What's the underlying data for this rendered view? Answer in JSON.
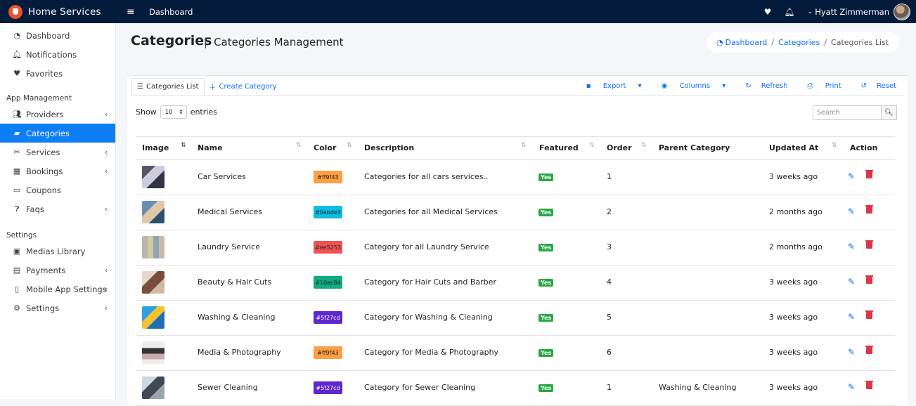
{
  "topbar": {
    "brand": "Home Services",
    "menu_icon": "≡",
    "page_label": "Dashboard",
    "user_name": "Hyatt Zimmerman"
  },
  "sidebar": {
    "items_top": [
      {
        "label": "Dashboard",
        "icon": "dashboard-icon"
      },
      {
        "label": "Notifications",
        "icon": "bell-icon"
      },
      {
        "label": "Favorites",
        "icon": "heart-icon"
      }
    ],
    "section_app": "App Management",
    "items_app": [
      {
        "label": "Providers",
        "icon": "users-icon",
        "has_children": true
      },
      {
        "label": "Categories",
        "icon": "folder-icon",
        "active": true
      },
      {
        "label": "Services",
        "icon": "tools-icon",
        "has_children": true
      },
      {
        "label": "Bookings",
        "icon": "calendar-icon",
        "has_children": true
      },
      {
        "label": "Coupons",
        "icon": "ticket-icon"
      },
      {
        "label": "Faqs",
        "icon": "question-icon",
        "has_children": true
      }
    ],
    "section_settings": "Settings",
    "items_settings": [
      {
        "label": "Medias Library",
        "icon": "images-icon"
      },
      {
        "label": "Payments",
        "icon": "money-icon",
        "has_children": true
      },
      {
        "label": "Mobile App Settings",
        "icon": "mobile-icon",
        "has_children": true
      },
      {
        "label": "Settings",
        "icon": "cogs-icon",
        "has_children": true
      }
    ]
  },
  "header": {
    "title": "Categories",
    "subtitle": "Categories Management",
    "breadcrumb": [
      "Dashboard",
      "Categories",
      "Categories List"
    ]
  },
  "tabs": {
    "list": "Categories List",
    "create": "Create Category"
  },
  "tools": {
    "export": "Export",
    "columns": "Columns",
    "refresh": "Refresh",
    "print": "Print",
    "reset": "Reset"
  },
  "length": {
    "show": "Show",
    "value": "10",
    "entries": "entries"
  },
  "search": {
    "placeholder": "Search"
  },
  "table": {
    "columns": [
      "Image",
      "Name",
      "Color",
      "Description",
      "Featured",
      "Order",
      "Parent Category",
      "Updated At",
      "Action"
    ],
    "rows": [
      {
        "name": "Car Services",
        "color": "#ff9f43",
        "description": "Categories for all cars services..",
        "featured": "Yes",
        "order": "1",
        "parent": "",
        "updated": "3 weeks ago"
      },
      {
        "name": "Medical Services",
        "color": "#0abde3",
        "description": "Categories for all Medical Services",
        "featured": "Yes",
        "order": "2",
        "parent": "",
        "updated": "2 months ago"
      },
      {
        "name": "Laundry Service",
        "color": "#ee5253",
        "description": "Category for all Laundry Service",
        "featured": "Yes",
        "order": "3",
        "parent": "",
        "updated": "2 months ago"
      },
      {
        "name": "Beauty & Hair Cuts",
        "color": "#10ac84",
        "description": "Category for Hair Cuts and Barber",
        "featured": "Yes",
        "order": "4",
        "parent": "",
        "updated": "3 weeks ago"
      },
      {
        "name": "Washing & Cleaning",
        "color": "#5f27cd",
        "description": "Category for Washing & Cleaning",
        "featured": "Yes",
        "order": "5",
        "parent": "",
        "updated": "3 weeks ago"
      },
      {
        "name": "Media & Photography",
        "color": "#ff9f43",
        "description": "Category for Media & Photography",
        "featured": "Yes",
        "order": "6",
        "parent": "",
        "updated": "3 weeks ago"
      },
      {
        "name": "Sewer Cleaning",
        "color": "#5f27cd",
        "description": "Category for Sewer Cleaning",
        "featured": "Yes",
        "order": "1",
        "parent": "Washing & Cleaning",
        "updated": "3 weeks ago"
      }
    ]
  }
}
